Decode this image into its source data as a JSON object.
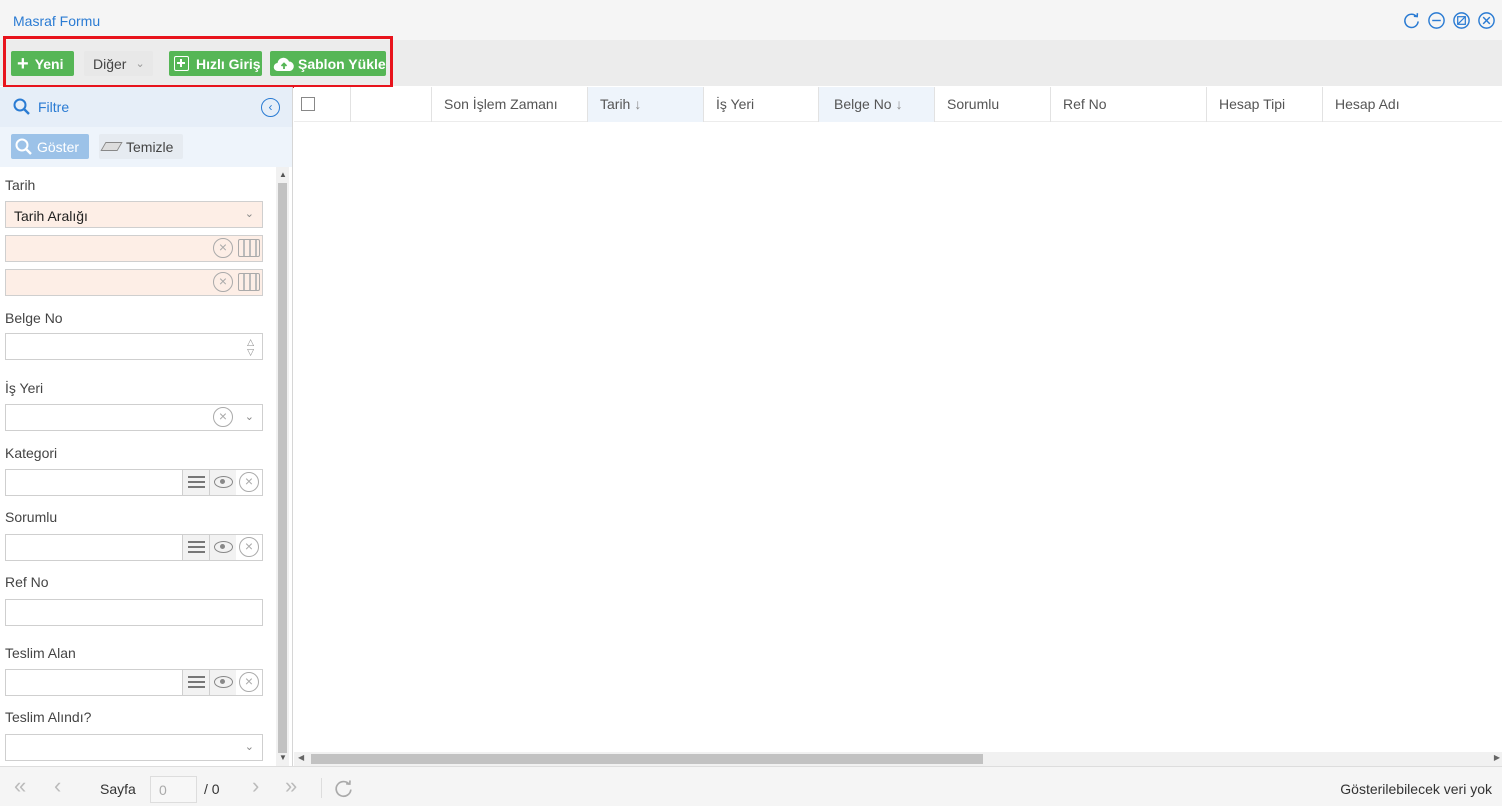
{
  "window": {
    "title": "Masraf Formu",
    "controls": [
      "refresh-icon",
      "minimize-icon",
      "maximize-icon",
      "close-icon"
    ],
    "accent_color": "#2a7bd3"
  },
  "toolbar": {
    "yeni_label": "Yeni",
    "diger_label": "Diğer",
    "hizli_giris_label": "Hızlı Giriş",
    "sablon_yukle_label": "Şablon Yükle",
    "button_color": "#56b656",
    "highlight_color": "#e8131c"
  },
  "filter": {
    "title": "Filtre",
    "goster_label": "Göster",
    "temizle_label": "Temizle",
    "fields": {
      "tarih_label": "Tarih",
      "tarih_range_value": "Tarih Aralığı",
      "tarih_start_value": "",
      "tarih_end_value": "",
      "belge_no_label": "Belge No",
      "belge_no_value": "",
      "is_yeri_label": "İş Yeri",
      "is_yeri_value": "",
      "kategori_label": "Kategori",
      "kategori_value": "",
      "sorumlu_label": "Sorumlu",
      "sorumlu_value": "",
      "ref_no_label": "Ref No",
      "ref_no_value": "",
      "teslim_alan_label": "Teslim Alan",
      "teslim_alan_value": "",
      "teslim_alindi_label": "Teslim Alındı?",
      "teslim_alindi_value": ""
    }
  },
  "grid": {
    "columns": [
      {
        "label": ""
      },
      {
        "label": "Son İşlem Zamanı"
      },
      {
        "label": "Tarih",
        "sorted": "desc"
      },
      {
        "label": "İş Yeri"
      },
      {
        "label": "Belge No",
        "sorted": "desc"
      },
      {
        "label": "Sorumlu"
      },
      {
        "label": "Ref No"
      },
      {
        "label": "Hesap Tipi"
      },
      {
        "label": "Hesap Adı"
      }
    ],
    "rows": []
  },
  "pager": {
    "sayfa_label": "Sayfa",
    "current_page": "0",
    "total_pages": "/ 0",
    "status": "Gösterilebilecek veri yok"
  }
}
